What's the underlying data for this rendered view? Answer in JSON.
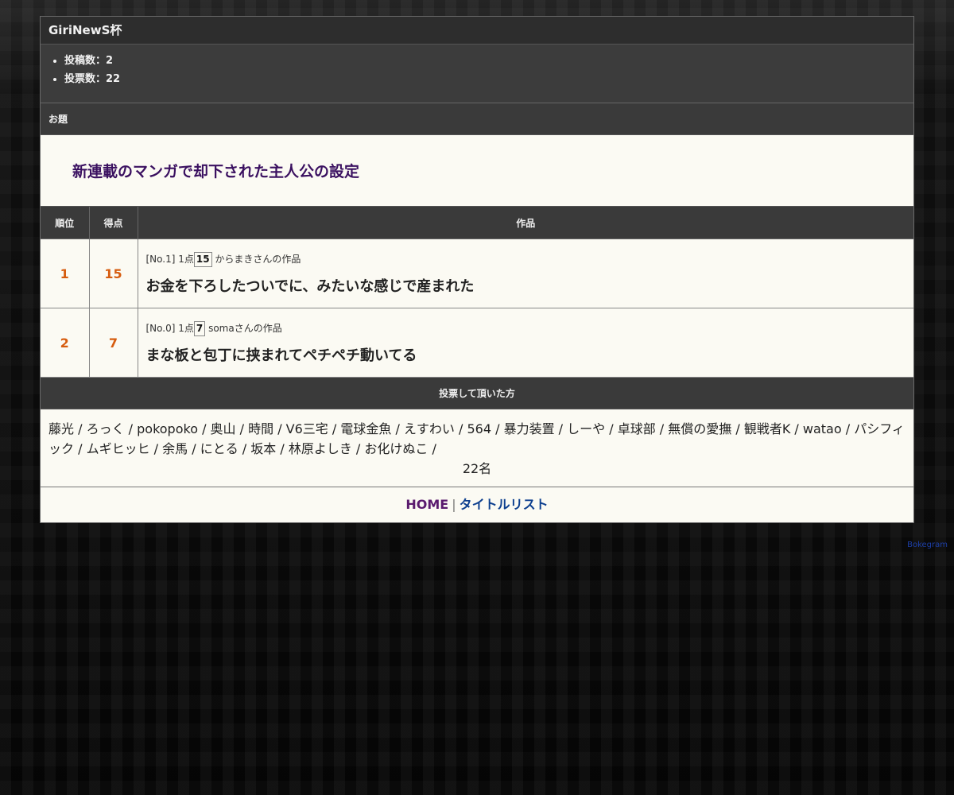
{
  "header": {
    "title": "GiriNewS杯"
  },
  "stats": [
    {
      "label": "投稿数：2"
    },
    {
      "label": "投票数：22"
    }
  ],
  "topic": {
    "heading": "お題",
    "text": "新連載のマンガで却下された主人公の設定"
  },
  "table": {
    "headers": {
      "rank": "順位",
      "score": "得点",
      "work": "作品"
    },
    "rows": [
      {
        "rank": "1",
        "score": "15",
        "entry_no": "[No.1]",
        "point_unit": "1点",
        "points": "15",
        "author": "からまきさんの作品",
        "text": "お金を下ろしたついでに、みたいな感じで産まれた"
      },
      {
        "rank": "2",
        "score": "7",
        "entry_no": "[No.0]",
        "point_unit": "1点",
        "points": "7",
        "author": "somaさんの作品",
        "text": "まな板と包丁に挟まれてペチペチ動いてる"
      }
    ]
  },
  "voters": {
    "heading": "投票して頂いた方",
    "list": "藤光 / ろっく / pokopoko / 奥山 / 時間 / V6三宅 / 電球金魚 / えすわい / 564 / 暴力装置 / しーや / 卓球部 / 無償の愛撫 / 観戦者K / watao / パシフィック / ムギヒッヒ / 余馬 / にとる / 坂本 / 林原よしき / お化けぬこ /",
    "count": "22名"
  },
  "footer": {
    "home": "HOME",
    "separator": "|",
    "title_list": "タイトルリスト"
  },
  "brand": "Bokegram"
}
